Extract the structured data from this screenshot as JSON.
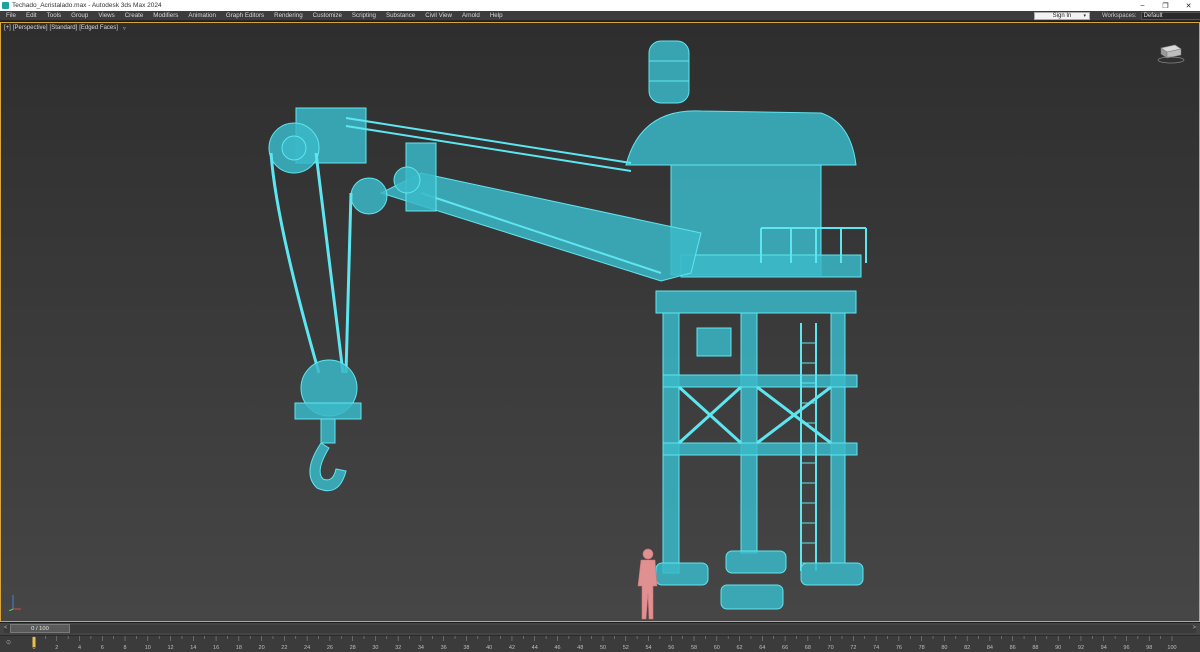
{
  "window": {
    "title": "Techado_Acristalado.max - Autodesk 3ds Max 2024",
    "minimize_glyph": "–",
    "restore_glyph": "❐",
    "close_glyph": "✕"
  },
  "menubar": {
    "items": [
      "File",
      "Edit",
      "Tools",
      "Group",
      "Views",
      "Create",
      "Modifiers",
      "Animation",
      "Graph Editors",
      "Rendering",
      "Customize",
      "Scripting",
      "Substance",
      "Civil View",
      "Arnold",
      "Help"
    ]
  },
  "signin": {
    "label": "Sign In"
  },
  "workspaces": {
    "label": "Workspaces:",
    "value": "Default"
  },
  "viewport": {
    "labels": [
      "[+]",
      "[Perspective]",
      "[Standard]",
      "[Edged Faces]"
    ],
    "filter_icon": "filter-icon",
    "wire_color": "#5ee6f0",
    "fill_color": "#3bb8c8",
    "human_color": "#e09090"
  },
  "timeslider": {
    "position": "0 / 100",
    "current_frame": 0,
    "total_frames": 100,
    "prev_glyph": "<",
    "next_glyph": ">"
  },
  "trackbar": {
    "ticks": [
      0,
      2,
      4,
      6,
      8,
      10,
      12,
      14,
      16,
      18,
      20,
      22,
      24,
      26,
      28,
      30,
      32,
      34,
      36,
      38,
      40,
      42,
      44,
      46,
      48,
      50,
      52,
      54,
      56,
      58,
      60,
      62,
      64,
      66,
      68,
      70,
      72,
      74,
      76,
      78,
      80,
      82,
      84,
      86,
      88,
      90,
      92,
      94,
      96,
      98,
      100
    ],
    "key_icon": "key-filter-icon"
  }
}
